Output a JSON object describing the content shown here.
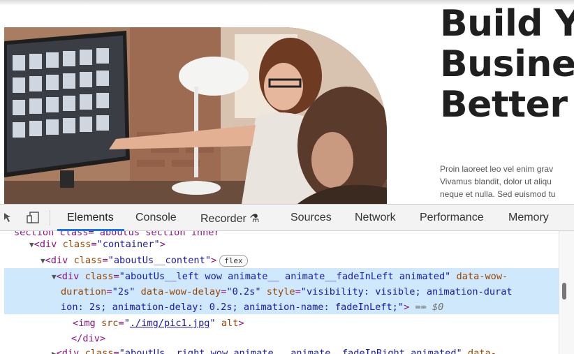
{
  "website": {
    "headline_lines": [
      "Build Y",
      "Busine",
      "Better"
    ],
    "body_lines": [
      "Proin laoreet leo vel enim grav",
      "Vivamus blandit, dolor ut aliqu",
      "neque et nulla. Sed euismod tu"
    ]
  },
  "devtools": {
    "tabs": [
      "Elements",
      "Console",
      "Recorder",
      "Sources",
      "Network",
      "Performance",
      "Memory"
    ],
    "active_tab": "Elements"
  },
  "elements_panel": {
    "partial_top_line": "section class=\"aboutus section inner\"",
    "container_tag": "div",
    "container_class": "container",
    "content_class": "aboutUs__content",
    "flex_badge": "flex",
    "selected_class": "aboutUs__left wow animate__ animate__fadeInLeft animated",
    "wow_duration_attr": "data-wow-",
    "wow_duration_attr2": "duration",
    "wow_duration_val": "2s",
    "wow_delay_attr": "data-wow-delay",
    "wow_delay_val": "0.2s",
    "style_attr": "style",
    "style_val_part1": "visibility: visible; animation-durat",
    "style_val_part2": "ion: 2s; animation-delay: 0.2s; animation-name: fadeInLeft;",
    "console_ref": "== $0",
    "img_tag": "img",
    "img_src": "./img/pic1.jpg",
    "img_alt": "alt",
    "close_div": "</div>",
    "next_class": "aboutUs__right wow animate__ animate__fadeInRight animated",
    "next_data": "data-"
  }
}
